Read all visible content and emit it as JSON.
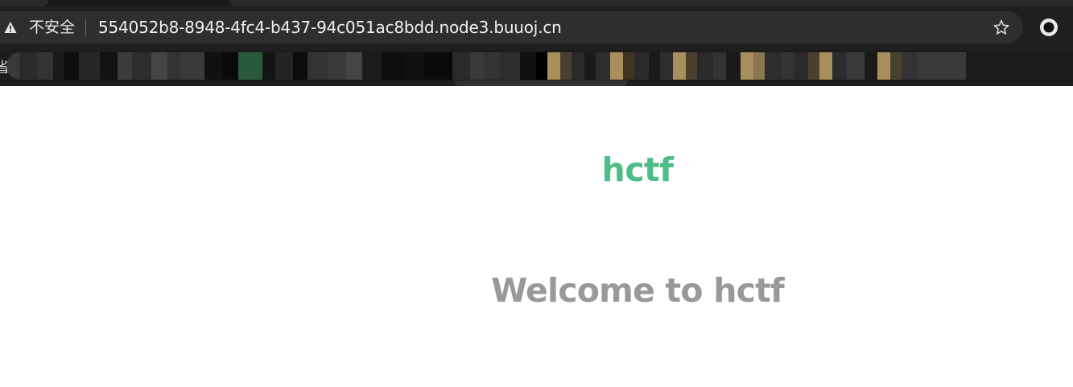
{
  "browser": {
    "security_label": "不安全",
    "url": "554052b8-8948-4fc4-b437-94c051ac8bdd.node3.buuoj.cn",
    "bookmark_partial": "省"
  },
  "icons": {
    "security": "warning-triangle-icon",
    "bookmark": "star-icon",
    "profile": "profile-circle-icon"
  },
  "page": {
    "site_title": "hctf",
    "welcome_heading": "Welcome to hctf"
  },
  "colors": {
    "title_green": "#4dbd87",
    "heading_gray": "#999999",
    "chrome_dark": "#1f1f1f"
  }
}
